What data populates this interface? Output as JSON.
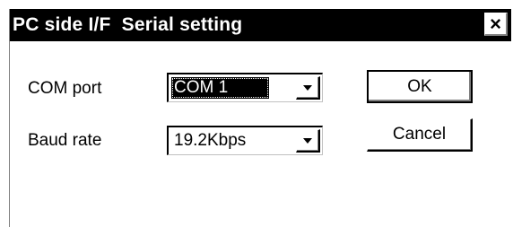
{
  "window": {
    "title": "PC side I/F  Serial setting",
    "close_glyph": "×"
  },
  "form": {
    "com_port": {
      "label": "COM port",
      "value": "COM 1"
    },
    "baud_rate": {
      "label": "Baud rate",
      "value": "19.2Kbps"
    }
  },
  "buttons": {
    "ok_label": "OK",
    "cancel_label": "Cancel"
  },
  "icons": {
    "close": "close-icon",
    "dropdown": "chevron-down-icon"
  },
  "colors": {
    "titlebar": "#000000",
    "title_text": "#ffffff",
    "background": "#ffffff",
    "selection": "#000000"
  }
}
